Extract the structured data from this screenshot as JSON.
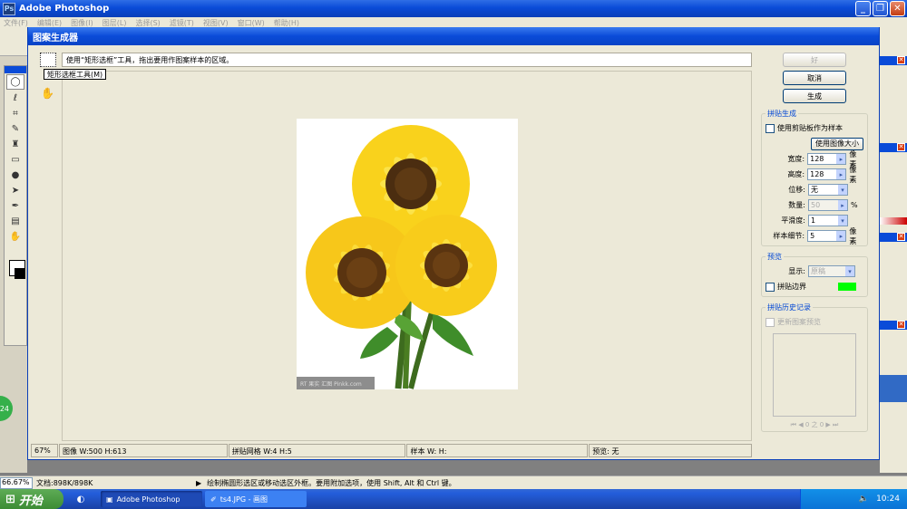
{
  "app": {
    "title": "Adobe Photoshop"
  },
  "menubar": {
    "items": [
      "文件(F)",
      "编辑(E)",
      "图像(I)",
      "图层(L)",
      "选择(S)",
      "滤镜(T)",
      "视图(V)",
      "窗口(W)",
      "帮助(H)"
    ]
  },
  "dialog": {
    "title": "图案生成器",
    "hint": "使用“矩形选框”工具，拖出要用作图案样本的区域。",
    "tooltip": "矩形选框工具(M)",
    "status": {
      "zoom": "67%",
      "image": "图像 W:500 H:613",
      "grid": "拼贴网格 W:4 H:5",
      "sample": "样本 W:        H:",
      "preview": "预览: 无"
    },
    "watermark": "RT 果实  汇图 Pinkk.com",
    "buttons": {
      "ok": "好",
      "cancel": "取消",
      "generate": "生成"
    },
    "tile_gen": {
      "legend": "拼贴生成",
      "use_clipboard": "使用剪贴板作为样本",
      "use_image_size": "使用图像大小",
      "width_label": "宽度:",
      "width_value": "128",
      "width_unit": "像素",
      "height_label": "高度:",
      "height_value": "128",
      "height_unit": "像素",
      "offset_label": "位移:",
      "offset_value": "无",
      "amount_label": "数量:",
      "amount_value": "50",
      "amount_unit": "%",
      "smooth_label": "平滑度:",
      "smooth_value": "1",
      "detail_label": "样本细节:",
      "detail_value": "5",
      "detail_unit": "像素"
    },
    "preview": {
      "legend": "预览",
      "show_label": "显示:",
      "show_value": "原稿",
      "tile_border": "拼贴边界",
      "border_color": "#00ff00"
    },
    "history": {
      "legend": "拼贴历史记录",
      "update": "更新图案预览",
      "nav": "0 之 0"
    }
  },
  "statusbar": {
    "zoom": "66.67%",
    "doc": "文档:898K/898K",
    "hint": "绘制椭圆形选区或移动选区外框。要用附加选项，使用 Shift, Alt 和 Ctrl 键。"
  },
  "taskbar": {
    "start": "开始",
    "tasks": [
      "Adobe Photoshop",
      "ts4.JPG - 画图"
    ],
    "clock": "10:24"
  },
  "badge": "24"
}
